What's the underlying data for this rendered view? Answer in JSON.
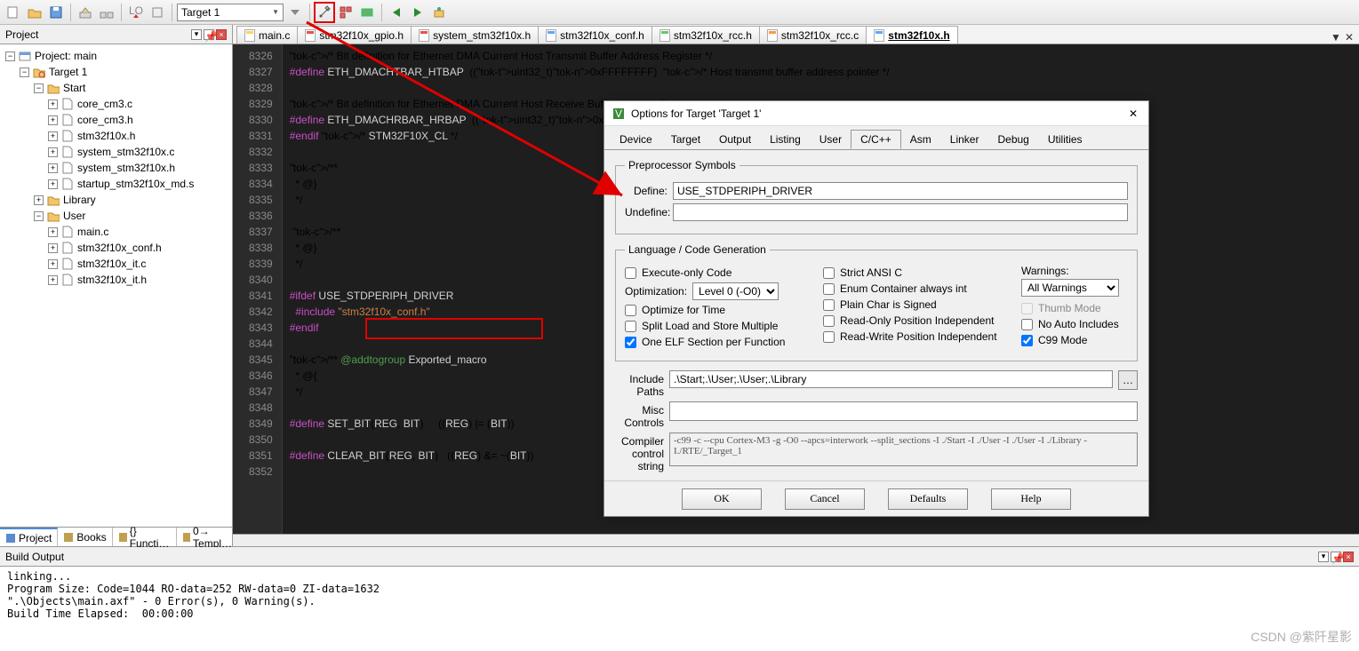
{
  "toolbar": {
    "target_value": "Target 1"
  },
  "panels": {
    "project_title": "Project",
    "build_title": "Build Output"
  },
  "bottom_tabs": [
    "Project",
    "Books",
    "{} Functi…",
    "0→ Templ…"
  ],
  "tree": {
    "root": "Project: main",
    "target": "Target 1",
    "groups": [
      {
        "name": "Start",
        "files": [
          "core_cm3.c",
          "core_cm3.h",
          "stm32f10x.h",
          "system_stm32f10x.c",
          "system_stm32f10x.h",
          "startup_stm32f10x_md.s"
        ]
      },
      {
        "name": "Library",
        "files": []
      },
      {
        "name": "User",
        "files": [
          "main.c",
          "stm32f10x_conf.h",
          "stm32f10x_it.c",
          "stm32f10x_it.h"
        ]
      }
    ]
  },
  "file_tabs": [
    {
      "label": "main.c",
      "cls": "tc-y"
    },
    {
      "label": "stm32f10x_gpio.h",
      "cls": "tc-r"
    },
    {
      "label": "system_stm32f10x.h",
      "cls": "tc-r"
    },
    {
      "label": "stm32f10x_conf.h",
      "cls": "tc-b"
    },
    {
      "label": "stm32f10x_rcc.h",
      "cls": "tc-g"
    },
    {
      "label": "stm32f10x_rcc.c",
      "cls": "tc-o"
    },
    {
      "label": "stm32f10x.h",
      "cls": "tc-b",
      "active": true
    }
  ],
  "code_start": 8326,
  "code_lines": [
    "/* Bit definition for Ethernet DMA Current Host Transmit Buffer Address Register */",
    "#define ETH_DMACHTBAR_HTBAP  ((uint32_t)0xFFFFFFFF)  /* Host transmit buffer address pointer */",
    "",
    "/* Bit definition for Ethernet DMA Current Host Receive Buffer Address Register */",
    "#define ETH_DMACHRBAR_HRBAP  ((uint32_t)0xFFFFFFFF)  /* Host receive buffer address pointer */",
    "#endif /* STM32F10X_CL */",
    "",
    "/**",
    "  * @}",
    "  */",
    "",
    " /**",
    "  * @}",
    "  */ ",
    "",
    "#ifdef USE_STDPERIPH_DRIVER",
    "  #include \"stm32f10x_conf.h\"",
    "#endif",
    "",
    "/** @addtogroup Exported_macro",
    "  * @{",
    "  */",
    "",
    "#define SET_BIT(REG, BIT)     ((REG) |= (BIT))",
    "",
    "#define CLEAR_BIT(REG, BIT)   ((REG) &= ~(BIT))",
    ""
  ],
  "build_output": "linking...\nProgram Size: Code=1044 RO-data=252 RW-data=0 ZI-data=1632\n\".\\Objects\\main.axf\" - 0 Error(s), 0 Warning(s).\nBuild Time Elapsed:  00:00:00",
  "dialog": {
    "title": "Options for Target 'Target 1'",
    "tabs": [
      "Device",
      "Target",
      "Output",
      "Listing",
      "User",
      "C/C++",
      "Asm",
      "Linker",
      "Debug",
      "Utilities"
    ],
    "active_tab": "C/C++",
    "preproc": {
      "legend": "Preprocessor Symbols",
      "define_lab": "Define:",
      "define_val": "USE_STDPERIPH_DRIVER",
      "undefine_lab": "Undefine:",
      "undefine_val": ""
    },
    "lang": {
      "legend": "Language / Code Generation",
      "exec_only": "Execute-only Code",
      "opt_lab": "Optimization:",
      "opt_val": "Level 0 (-O0)",
      "opt_time": "Optimize for Time",
      "split_load": "Split Load and Store Multiple",
      "one_elf": "One ELF Section per Function",
      "one_elf_chk": true,
      "strict": "Strict ANSI C",
      "enum": "Enum Container always int",
      "plainchar": "Plain Char is Signed",
      "ro_pi": "Read-Only Position Independent",
      "rw_pi": "Read-Write Position Independent",
      "warn_lab": "Warnings:",
      "warn_val": "All Warnings",
      "thumb": "Thumb Mode",
      "noauto": "No Auto Includes",
      "c99": "C99 Mode",
      "c99_chk": true
    },
    "include_lab": "Include\nPaths",
    "include_val": ".\\Start;.\\User;.\\User;.\\Library",
    "misc_lab": "Misc\nControls",
    "misc_val": "",
    "ctrlstr_lab": "Compiler\ncontrol\nstring",
    "ctrlstr_val": "-c99 -c --cpu Cortex-M3 -g -O0 --apcs=interwork --split_sections -I ./Start -I ./User -I ./User -I ./Library\n-I./RTE/_Target_1",
    "buttons": {
      "ok": "OK",
      "cancel": "Cancel",
      "defaults": "Defaults",
      "help": "Help"
    }
  },
  "watermark": "CSDN @紫阡星影"
}
